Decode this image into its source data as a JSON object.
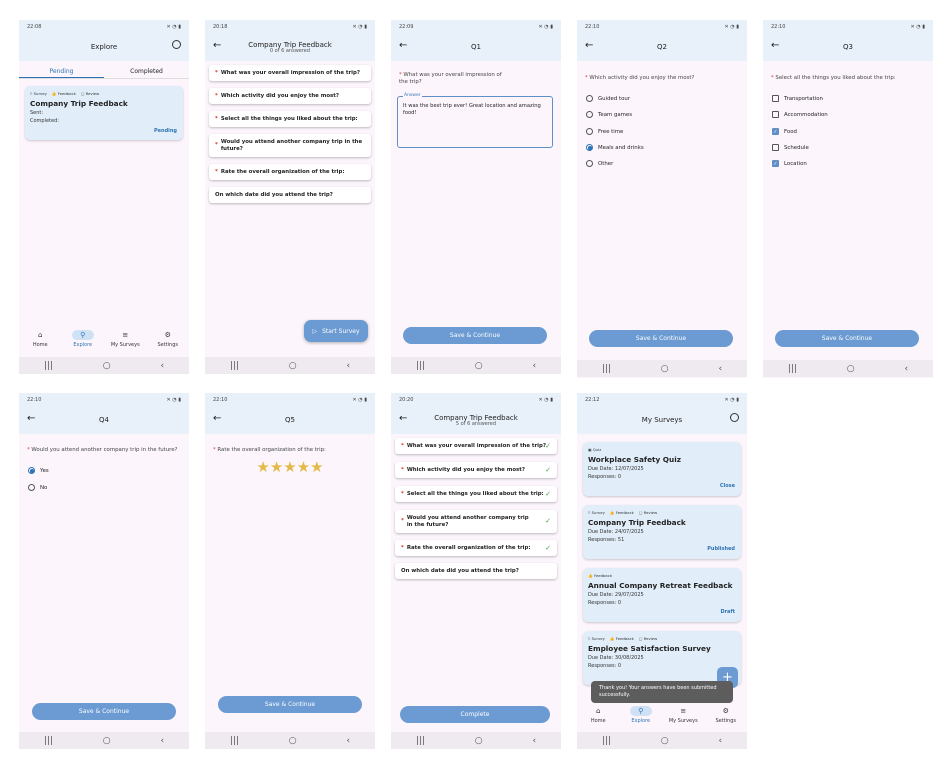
{
  "status": {
    "t1": "22:08",
    "t2": "20:18",
    "t3": "22:09",
    "t4": "22:10",
    "t5": "22:10",
    "t6": "22:10",
    "t7": "22:10",
    "t8": "20:20",
    "t9": "22:12"
  },
  "explore": {
    "title": "Explore",
    "tabs": [
      "Pending",
      "Completed"
    ],
    "card": {
      "tags": [
        "Survey",
        "Feedback",
        "Review"
      ],
      "title": "Company Trip Feedback",
      "sent": "Sent:",
      "completed": "Completed:",
      "status": "Pending"
    },
    "nav": [
      "Home",
      "Explore",
      "My Surveys",
      "Settings"
    ]
  },
  "survey": {
    "title": "Company Trip Feedback",
    "progress0": "0 of 6 answered",
    "progress5": "5 of 6 answered",
    "questions": [
      "What was your overall impression of the trip?",
      "Which activity did you enjoy the most?",
      "Select all the things you liked about the trip:",
      "Would you attend another company trip in the future?",
      "Rate the overall organization of the trip:",
      "On which date did you attend the trip?"
    ],
    "start": "Start Survey",
    "complete": "Complete"
  },
  "q1": {
    "title": "Q1",
    "label": "What was your overall impression of the trip?",
    "field_label": "Answer",
    "answer": "It was the best trip ever! Great location and amazing food!"
  },
  "q2": {
    "title": "Q2",
    "label": "Which activity did you enjoy the most?",
    "options": [
      "Guided tour",
      "Team games",
      "Free time",
      "Meals and drinks",
      "Other"
    ],
    "selected": 3
  },
  "q3": {
    "title": "Q3",
    "label": "Select all the things you liked about the trip:",
    "options": [
      "Transportation",
      "Accommodation",
      "Food",
      "Schedule",
      "Location"
    ],
    "checked": [
      2,
      4
    ]
  },
  "q4": {
    "title": "Q4",
    "label": "Would you attend another company trip in the future?",
    "options": [
      "Yes",
      "No"
    ],
    "selected": 0
  },
  "q5": {
    "title": "Q5",
    "label": "Rate the overall organization of the trip:",
    "rating": 5,
    "max": 5
  },
  "save": "Save & Continue",
  "mysurveys": {
    "title": "My Surveys",
    "cards": [
      {
        "tags": [
          "Quiz"
        ],
        "title": "Workplace Safety Quiz",
        "due": "Due Date: 12/07/2025",
        "resp": "Responses: 0",
        "status": "Close"
      },
      {
        "tags": [
          "Survey",
          "Feedback",
          "Review"
        ],
        "title": "Company Trip Feedback",
        "due": "Due Date: 24/07/2025",
        "resp": "Responses: 51",
        "status": "Published"
      },
      {
        "tags": [
          "Feedback"
        ],
        "title": "Annual Company Retreat Feedback",
        "due": "Due Date: 29/07/2025",
        "resp": "Responses: 0",
        "status": "Draft"
      },
      {
        "tags": [
          "Survey",
          "Feedback",
          "Review"
        ],
        "title": "Employee Satisfaction Survey",
        "due": "Due Date: 30/08/2025",
        "resp": "Responses: 0",
        "status": ""
      }
    ],
    "toast": "Thank you! Your answers have been submitted successfully."
  },
  "colors": {
    "accent": "#6b9bd2",
    "header": "#e8f0f9",
    "bg": "#fcf6fc",
    "star": "#e3b94a"
  }
}
